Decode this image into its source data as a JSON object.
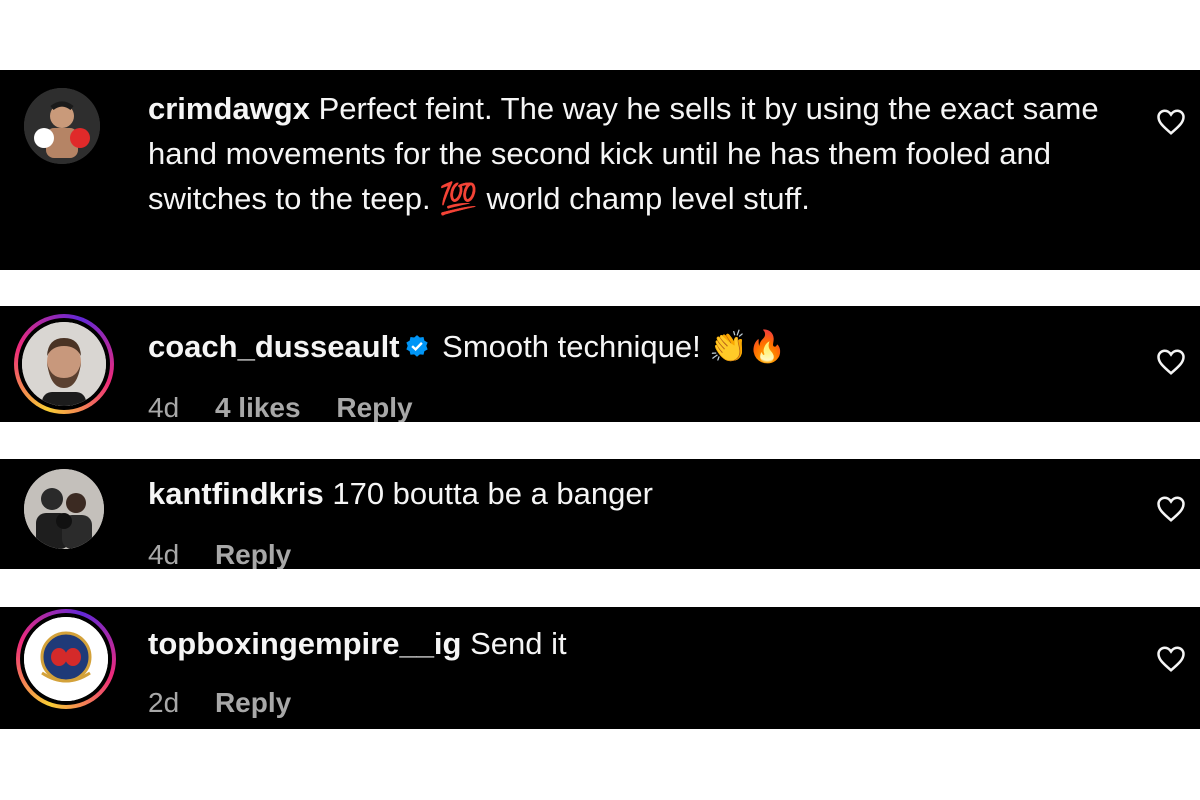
{
  "comments": [
    {
      "username": "crimdawgx",
      "text": "Perfect feint. The way he sells it by using the exact same hand movements for the second kick until he has them fooled and switches to the teep.",
      "emoji": "💯",
      "text_after": "world champ level stuff.",
      "avatar_icon": "boxer-avatar",
      "liked": false
    },
    {
      "username": "coach_dusseault",
      "verified": true,
      "text": "Smooth technique!",
      "emoji": "👏🔥",
      "time": "4d",
      "likes": "4 likes",
      "reply": "Reply",
      "avatar_icon": "bearded-man-avatar",
      "story_ring": true
    },
    {
      "username": "kantfindkris",
      "text": "170 boutta be a banger",
      "time": "4d",
      "reply": "Reply",
      "avatar_icon": "group-photo-avatar"
    },
    {
      "username": "topboxingempire__ig",
      "text": "Send it",
      "time": "2d",
      "reply": "Reply",
      "avatar_icon": "boxing-gloves-logo-avatar",
      "story_ring": true
    }
  ],
  "colors": {
    "background": "#000000",
    "text": "#f5f5f5",
    "meta": "#a8a8a8",
    "verified": "#0095f6"
  }
}
